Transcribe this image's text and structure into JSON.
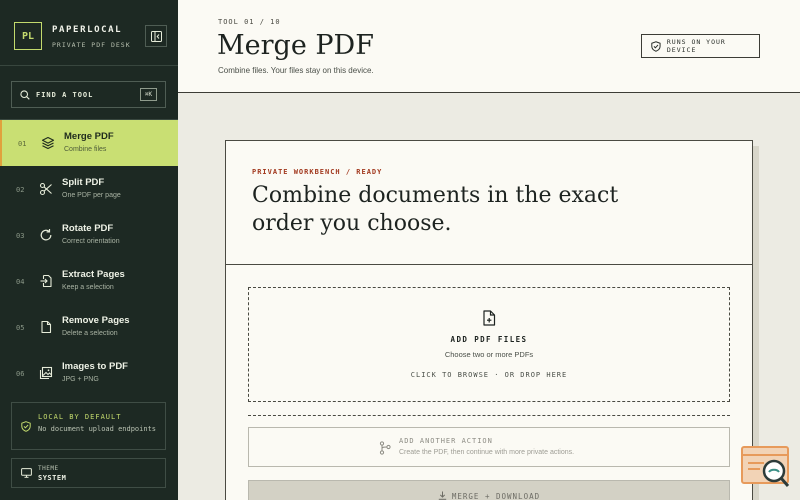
{
  "sidebar": {
    "brand_mark": "PL",
    "brand_name": "PAPERLOCAL",
    "brand_sub": "PRIVATE PDF DESK",
    "find_label": "FIND A TOOL",
    "find_shortcut": "⌘K",
    "items": [
      {
        "num": "01",
        "title": "Merge PDF",
        "sub": "Combine files",
        "icon": "layers-icon",
        "active": true
      },
      {
        "num": "02",
        "title": "Split PDF",
        "sub": "One PDF per page",
        "icon": "scissors-icon",
        "active": false
      },
      {
        "num": "03",
        "title": "Rotate PDF",
        "sub": "Correct orientation",
        "icon": "rotate-icon",
        "active": false
      },
      {
        "num": "04",
        "title": "Extract Pages",
        "sub": "Keep a selection",
        "icon": "extract-icon",
        "active": false
      },
      {
        "num": "05",
        "title": "Remove Pages",
        "sub": "Delete a selection",
        "icon": "file-icon",
        "active": false
      },
      {
        "num": "06",
        "title": "Images to PDF",
        "sub": "JPG + PNG",
        "icon": "images-icon",
        "active": false
      }
    ],
    "local_title": "LOCAL BY DEFAULT",
    "local_sub": "No document upload endpoints",
    "theme_label": "THEME",
    "theme_value": "SYSTEM"
  },
  "header": {
    "tool_label": "TOOL 01 / 10",
    "title": "Merge PDF",
    "subtitle": "Combine files. Your files stay on this device.",
    "device_button": "RUNS ON YOUR DEVICE"
  },
  "card": {
    "status": "PRIVATE WORKBENCH / READY",
    "headline": "Combine documents in the exact order you choose.",
    "drop_title": "ADD PDF FILES",
    "drop_sub": "Choose two or more PDFs",
    "drop_hint": "CLICK TO BROWSE · OR DROP HERE",
    "another_title": "ADD ANOTHER ACTION",
    "another_sub": "Create the PDF, then continue with more private actions.",
    "merge_label": "MERGE + DOWNLOAD"
  },
  "colors": {
    "sidebar_bg": "#1d2923",
    "accent": "#c9df73",
    "status_red": "#a2391f",
    "paper": "#fbfaf4"
  }
}
